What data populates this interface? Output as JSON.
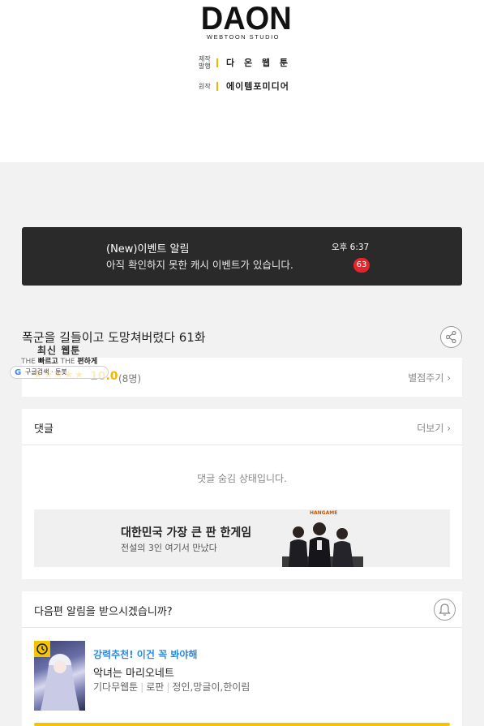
{
  "header": {
    "logo_main": "DAON",
    "logo_sub": "WEBTOON STUDIO",
    "credits": [
      {
        "label": "제작\n발행",
        "value": "다 온 웹 툰"
      },
      {
        "label": "원작",
        "value": "에이템포미디어"
      }
    ]
  },
  "event_notice": {
    "title": "(New)이벤트 알림",
    "description": "아직 확인하지 못한 캐시 이벤트가 있습니다.",
    "time": "오후 6:37",
    "count": "63",
    "badge_color": "#e8242b"
  },
  "episode": {
    "title": "폭군을 길들이고 도망쳐버렸다 61화",
    "share_icon": "share-icon"
  },
  "rating": {
    "stars": [
      "★",
      "★",
      "★",
      "★",
      "★"
    ],
    "score": "10.0",
    "count": "(8명)",
    "rate_label": "별점주기 ›",
    "star_color": "#f4b400"
  },
  "badge": {
    "title": "최신 웹툰",
    "sub_prefix_1": "THE",
    "sub_bold_1": "빠르고",
    "sub_prefix_2": "THE",
    "sub_bold_2": "편하게",
    "pill_text": "구글검색 · 툰봇"
  },
  "comments": {
    "title": "댓글",
    "more_label": "더보기 ›",
    "hidden_message": "댓글 숨김 상태입니다."
  },
  "ad": {
    "brand": "HANGAME",
    "title": "대한민국 가장 큰 판 한게임",
    "subtitle": "전설의 3인 여기서 만났다"
  },
  "notify": {
    "question": "다음편 알림을 받으시겠습니까?",
    "bell_icon": "bell-icon"
  },
  "recommendation": {
    "label": "강력추천! 이건 꼭 봐야해",
    "title": "악녀는 마리오네트",
    "meta": [
      "기다무웹툰",
      "로판",
      "정인,망글이,한이림"
    ],
    "label_color": "#2a8be0",
    "accent_color": "#f5c400"
  }
}
